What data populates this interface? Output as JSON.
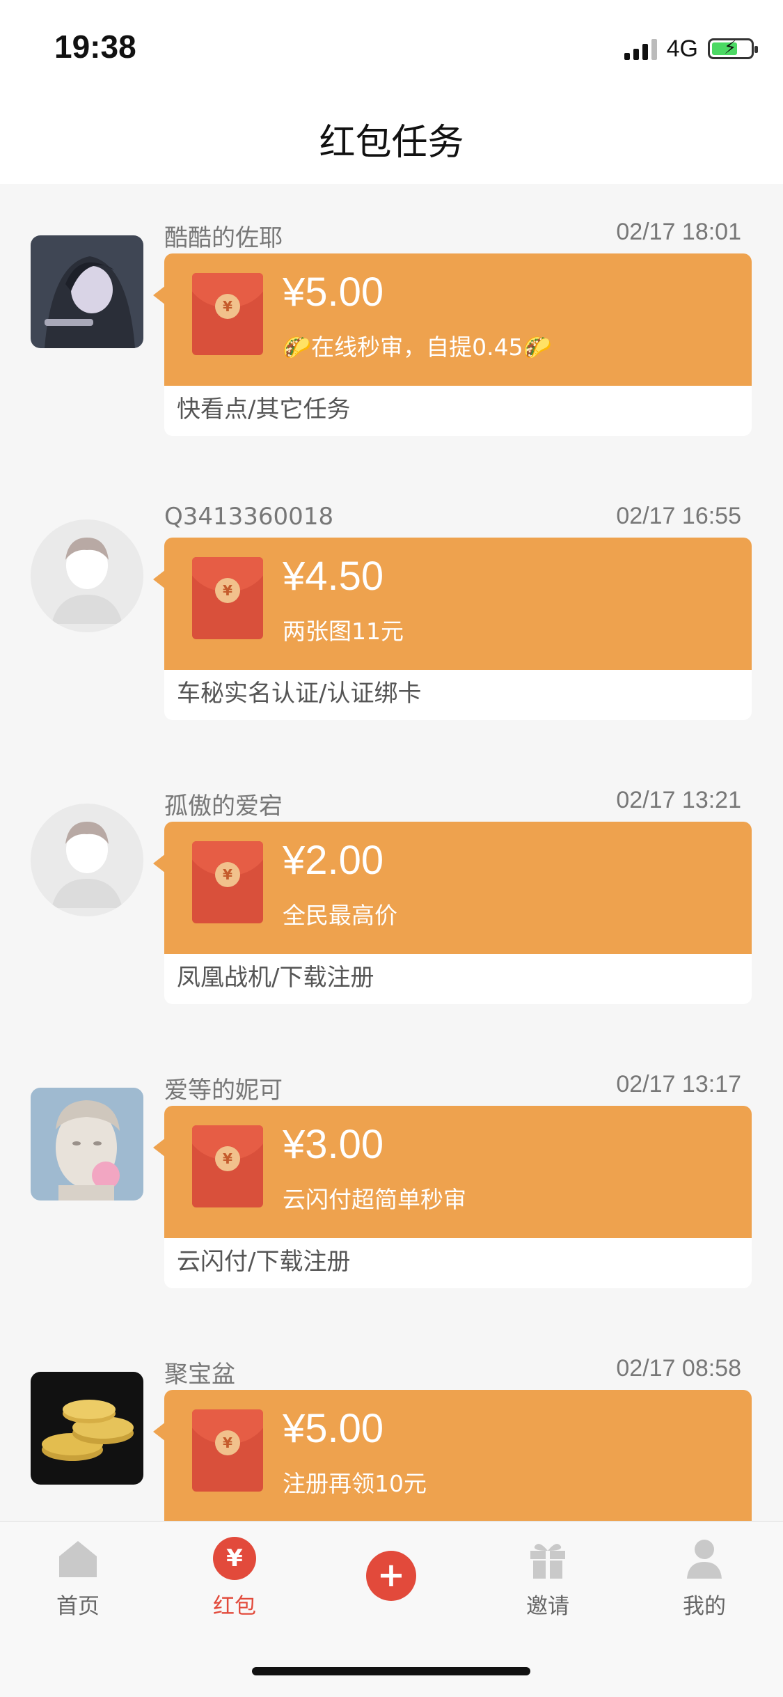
{
  "status": {
    "time": "19:38",
    "network": "4G"
  },
  "header": {
    "title": "红包任务"
  },
  "items": [
    {
      "username": "酷酷的佐耶",
      "time": "02/17 18:01",
      "amount": "¥5.00",
      "desc": "🌮在线秒审，自提0.45🌮",
      "category": "快看点/其它任务"
    },
    {
      "username": "Q3413360018",
      "time": "02/17 16:55",
      "amount": "¥4.50",
      "desc": "两张图11元",
      "category": "车秘实名认证/认证绑卡"
    },
    {
      "username": "孤傲的爱宕",
      "time": "02/17 13:21",
      "amount": "¥2.00",
      "desc": "全民最高价",
      "category": "凤凰战机/下载注册"
    },
    {
      "username": "爱等的妮可",
      "time": "02/17 13:17",
      "amount": "¥3.00",
      "desc": "云闪付超简单秒审",
      "category": "云闪付/下载注册"
    },
    {
      "username": "聚宝盆",
      "time": "02/17 08:58",
      "amount": "¥5.00",
      "desc": "注册再领10元",
      "category": ""
    }
  ],
  "tabs": [
    {
      "label": "首页",
      "icon": "home-icon"
    },
    {
      "label": "红包",
      "icon": "yuan-icon"
    },
    {
      "label": "",
      "icon": "plus-icon"
    },
    {
      "label": "邀请",
      "icon": "gift-icon"
    },
    {
      "label": "我的",
      "icon": "person-icon"
    }
  ],
  "colors": {
    "card": "#eea24e",
    "accent": "#e24a3b"
  },
  "icons": {
    "coin_symbol": "¥",
    "tab_yuan": "¥",
    "tab_plus": "+"
  }
}
